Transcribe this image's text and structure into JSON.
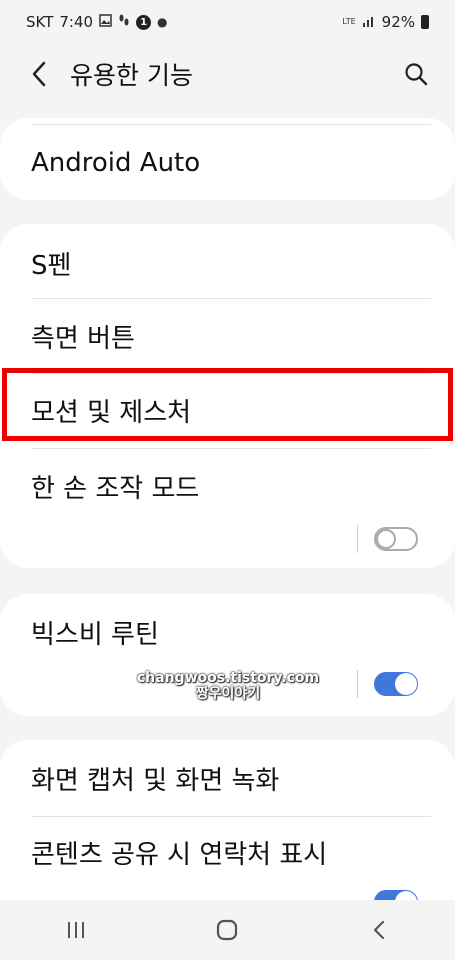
{
  "status_bar": {
    "carrier": "SKT",
    "time": "7:40",
    "notification_badge": "1",
    "network": "LTE",
    "battery": "92%"
  },
  "header": {
    "title": "유용한 기능"
  },
  "cards": {
    "android_auto": {
      "label": "Android Auto"
    },
    "spen": {
      "label": "S펜"
    },
    "side_button": {
      "label": "측면 버튼"
    },
    "motions": {
      "label": "모션 및 제스처"
    },
    "one_hand": {
      "label": "한 손 조작 모드",
      "enabled": false
    },
    "bixby_routines": {
      "label": "빅스비 루틴",
      "enabled": true
    },
    "screenshots": {
      "label": "화면 캡처 및 화면 녹화"
    },
    "share_contacts": {
      "label": "콘텐츠 공유 시 연락처 표시",
      "enabled": true
    }
  },
  "watermark": {
    "line1": "changwoos.tistory.com",
    "line2": "짱우이야기"
  },
  "colors": {
    "accent": "#3f77dc",
    "highlight": "#ee0000",
    "background": "#f4f4f4"
  }
}
